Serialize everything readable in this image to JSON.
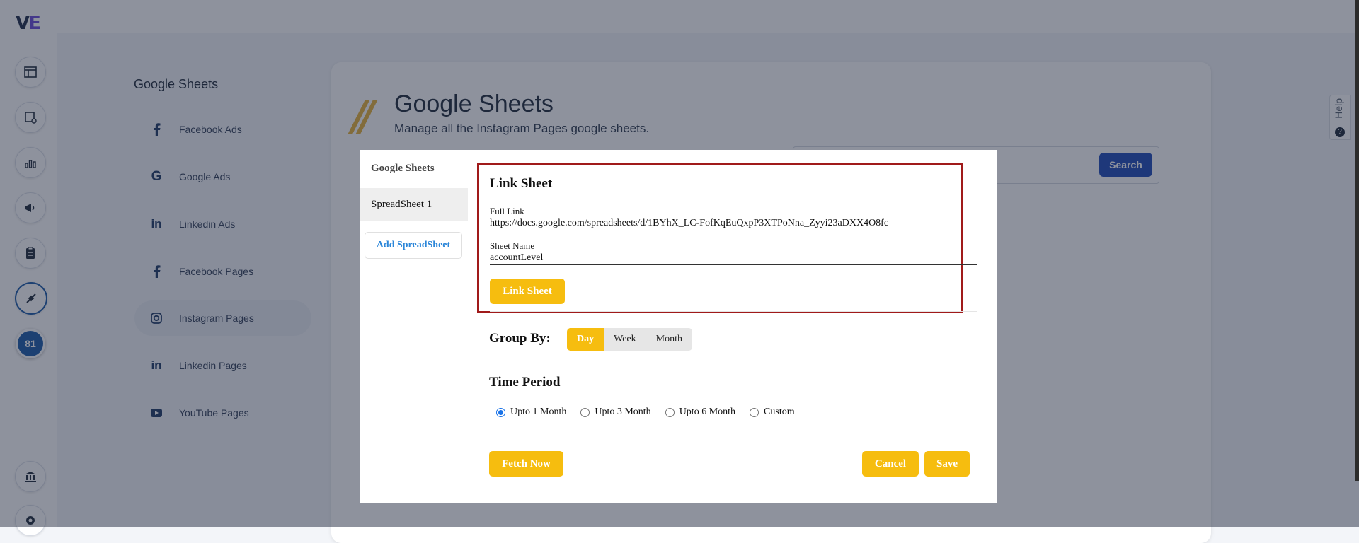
{
  "app": {
    "logo": "VE",
    "notification_count": "81"
  },
  "sidebar": {
    "title": "Google Sheets",
    "items": [
      {
        "label": "Facebook Ads",
        "icon": "facebook-icon"
      },
      {
        "label": "Google Ads",
        "icon": "google-icon"
      },
      {
        "label": "Linkedin Ads",
        "icon": "linkedin-icon"
      },
      {
        "label": "Facebook Pages",
        "icon": "facebook-icon"
      },
      {
        "label": "Instagram Pages",
        "icon": "instagram-icon",
        "active": true
      },
      {
        "label": "Linkedin Pages",
        "icon": "linkedin-icon"
      },
      {
        "label": "YouTube Pages",
        "icon": "youtube-icon"
      }
    ]
  },
  "main": {
    "title": "Google Sheets",
    "subtitle": "Manage all the Instagram Pages google sheets.",
    "search_button": "Search"
  },
  "help": {
    "label": "Help"
  },
  "modal": {
    "left_title": "Google Sheets",
    "sheets": [
      "SpreadSheet 1"
    ],
    "add_button": "Add SpreadSheet",
    "link_sheet": {
      "title": "Link Sheet",
      "full_link_label": "Full Link",
      "full_link_value": "https://docs.google.com/spreadsheets/d/1BYhX_LC-FofKqEuQxpP3XTPoNna_Zyyi23aDXX4O8fc",
      "sheet_name_label": "Sheet Name",
      "sheet_name_value": "accountLevel",
      "button": "Link Sheet"
    },
    "group_by": {
      "label": "Group By:",
      "options": [
        "Day",
        "Week",
        "Month"
      ],
      "selected": "Day"
    },
    "time_period": {
      "label": "Time Period",
      "options": [
        "Upto 1 Month",
        "Upto 3 Month",
        "Upto 6 Month",
        "Custom"
      ],
      "selected": "Upto 1 Month"
    },
    "fetch_button": "Fetch Now",
    "cancel_button": "Cancel",
    "save_button": "Save"
  },
  "colors": {
    "accent": "#f6bd0f",
    "primary": "#1f4bb8",
    "highlight_border": "#a01a1a"
  }
}
